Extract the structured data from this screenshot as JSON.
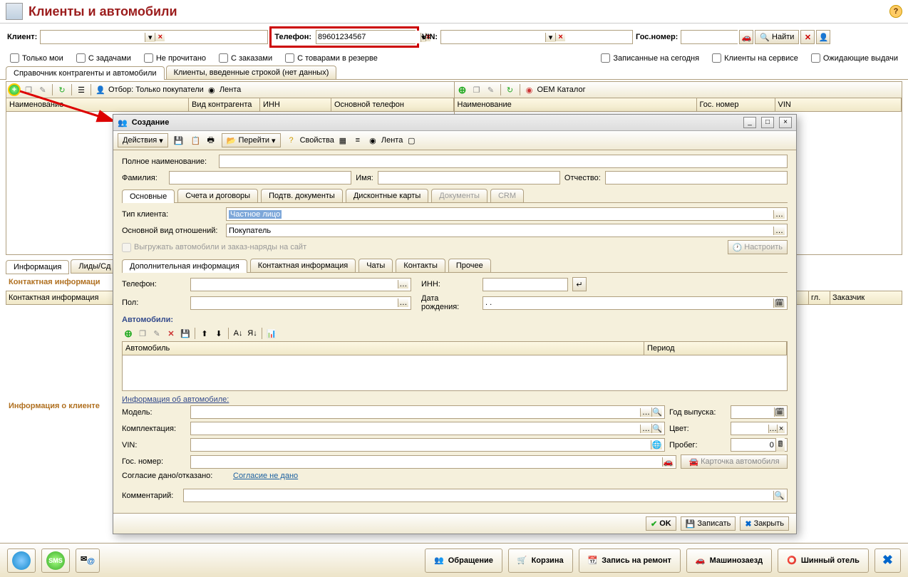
{
  "header": {
    "title": "Клиенты и автомобили"
  },
  "search": {
    "client_label": "Клиент:",
    "phone_label": "Телефон:",
    "phone_value": "89601234567",
    "vin_label": "VIN:",
    "gosnomer_label": "Гос.номер:",
    "find_label": "Найти"
  },
  "filters": {
    "only_mine": "Только мои",
    "with_tasks": "С задачами",
    "unread": "Не прочитано",
    "with_orders": "С заказами",
    "reserve": "С товарами в резерве",
    "today": "Записанные на сегодня",
    "service": "Клиенты на сервисе",
    "pickup": "Ожидающие выдачи"
  },
  "main_tabs": {
    "t1": "Справочник контрагенты и автомобили",
    "t2": "Клиенты, введенные строкой (нет данных)"
  },
  "left_toolbar": {
    "filter_label": "Отбор: Только покупатели",
    "lenta": "Лента"
  },
  "left_cols": {
    "name": "Наименование",
    "type": "Вид контрагента",
    "inn": "ИНН",
    "phone": "Основной телефон"
  },
  "right_toolbar": {
    "oem": "OEM Каталог"
  },
  "right_cols": {
    "name": "Наименование",
    "gos": "Гос. номер",
    "vin": "VIN"
  },
  "lower_tabs": {
    "info": "Информация",
    "leads": "Лиды/Сд"
  },
  "sections": {
    "contact_title": "Контактная информаци",
    "contact_row": "Контактная информация",
    "client_info_title": "Информация о клиенте",
    "zakazchik": "Заказчик",
    "gl": "гл."
  },
  "modal": {
    "title": "Создание",
    "actions": "Действия",
    "goto": "Перейти",
    "props": "Свойства",
    "lenta": "Лента",
    "full_name_label": "Полное наименование:",
    "surname_label": "Фамилия:",
    "name_label": "Имя:",
    "patronymic_label": "Отчество:",
    "tabs": {
      "main": "Основные",
      "accounts": "Счета и договоры",
      "docs": "Подтв. документы",
      "discount": "Дисконтные карты",
      "documents": "Документы",
      "crm": "CRM"
    },
    "client_type_label": "Тип клиента:",
    "client_type_value": "Частное лицо",
    "relation_label": "Основной вид отношений:",
    "relation_value": "Покупатель",
    "upload_site": "Выгружать автомобили и заказ-наряды на сайт",
    "configure": "Настроить",
    "sub_tabs": {
      "addinfo": "Дополнительная информация",
      "contact": "Контактная информация",
      "chats": "Чаты",
      "contacts": "Контакты",
      "other": "Прочее"
    },
    "phone_label": "Телефон:",
    "inn_label": "ИНН:",
    "gender_label": "Пол:",
    "birth_label": "Дата рождения:",
    "birth_value": ".  .",
    "cars_label": "Автомобили:",
    "car_cols": {
      "car": "Автомобиль",
      "period": "Период"
    },
    "car_info": "Информация об автомобиле:",
    "model_label": "Модель:",
    "complect_label": "Комплектация:",
    "vin_label": "VIN:",
    "gosnomer_label": "Гос. номер:",
    "year_label": "Год выпуска:",
    "color_label": "Цвет:",
    "mileage_label": "Пробег:",
    "mileage_value": "0",
    "card_link": "Карточка автомобиля",
    "consent_label": "Согласие дано/отказано:",
    "consent_value": "Согласие не дано",
    "comment_label": "Комментарий:",
    "ok": "OK",
    "save": "Записать",
    "close": "Закрыть"
  },
  "footer": {
    "appeal": "Обращение",
    "cart": "Корзина",
    "repair": "Запись на ремонт",
    "drivein": "Машинозаезд",
    "tirehotel": "Шинный отель"
  }
}
